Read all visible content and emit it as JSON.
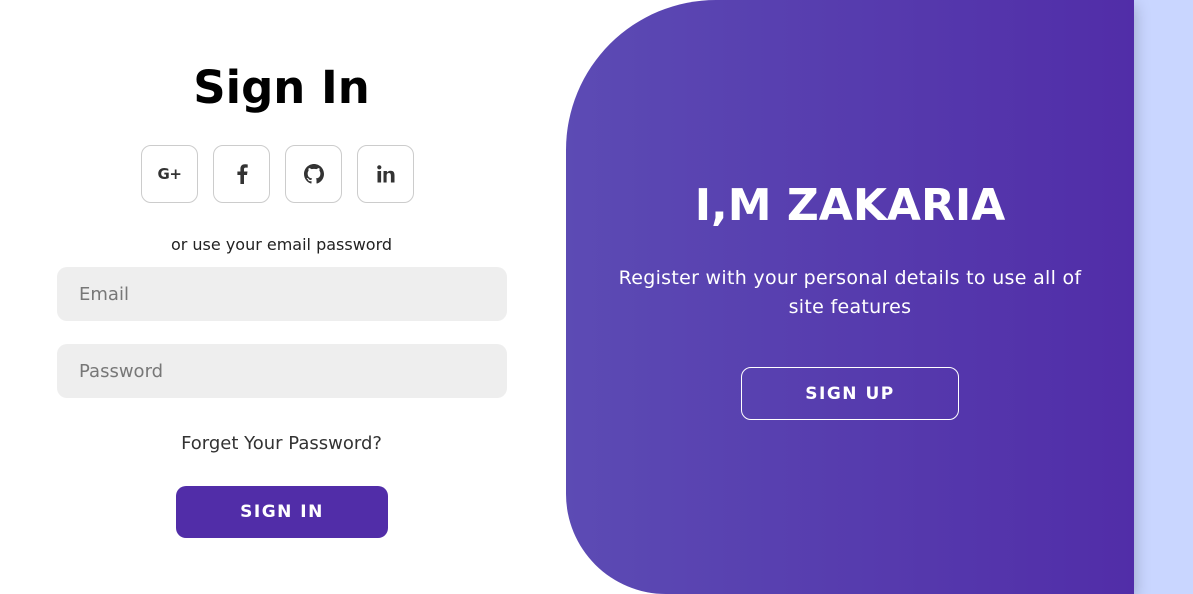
{
  "sign_in_form": {
    "title": "Sign In",
    "social_buttons": [
      {
        "icon": "google-plus-icon",
        "label": "G+"
      },
      {
        "icon": "facebook-icon"
      },
      {
        "icon": "github-icon"
      },
      {
        "icon": "linkedin-icon",
        "label": "in"
      }
    ],
    "hint": "or use your email password",
    "email_placeholder": "Email",
    "password_placeholder": "Password",
    "forgot_link": "Forget Your Password?",
    "submit_label": "SIGN IN"
  },
  "toggle_panel": {
    "title": "I,M ZAKARIA",
    "text": "Register with your personal details to use all of site features",
    "button_label": "SIGN UP"
  },
  "colors": {
    "accent": "#512da8",
    "gradient_start": "#5c4bb4",
    "gradient_end": "#512da8",
    "page_background": "#c9d6ff",
    "input_background": "#eeeeee"
  }
}
